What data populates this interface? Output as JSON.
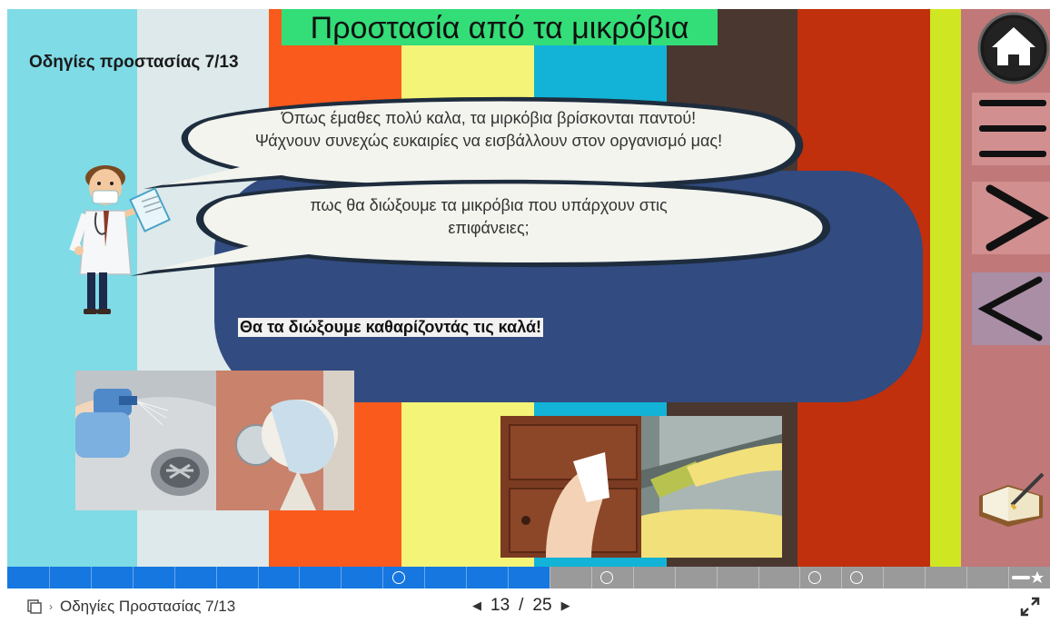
{
  "slide": {
    "title": "Προστασία από τα μικρόβια",
    "subtitle": "Οδηγίες προστασίας 7/13",
    "bubble1_line1": "Όπως έμαθες πολύ καλα, τα μιρκόβια βρίσκονται παντού!",
    "bubble1_line2": "Ψάχνουν συνεχώς ευκαιρίες να εισβάλλουν στον οργανισμό μας!",
    "bubble2_line1": "πως θα διώξουμε τα μικρόβια που υπάρχουν στις",
    "bubble2_line2": "επιφάνειες;",
    "answer": "Θα τα διώξουμε καθαρίζοντάς τις καλά!"
  },
  "stripe_colors": [
    "#7fdbe6",
    "#dde9ea",
    "#fb5a1d",
    "#f4f479",
    "#12b3d6",
    "#4a3730",
    "#c0300c",
    "#cfe622"
  ],
  "sidebar": {
    "home_icon": "home-icon",
    "menu_icon": "hamburger-menu-icon",
    "next_icon": "chevron-right-icon",
    "prev_icon": "chevron-left-icon",
    "notebook_icon": "notebook-pen-icon"
  },
  "progress": {
    "fill_fraction": 0.52,
    "markers": [
      "bookmark",
      "bookmark",
      "bookmark",
      "bookmark"
    ]
  },
  "footer": {
    "breadcrumb": "Οδηγίες Προστασίας 7/13",
    "current_page": "13",
    "separator": "/",
    "total_pages": "25"
  }
}
